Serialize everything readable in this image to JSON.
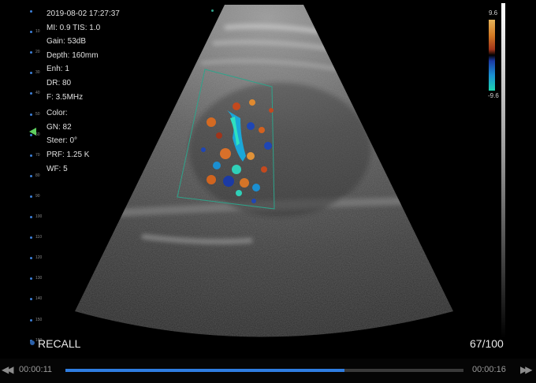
{
  "info": {
    "timestamp": "2019-08-02 17:27:37",
    "mi_tis": "MI: 0.9  TIS: 1.0",
    "gain": "Gain: 53dB",
    "depth": "Depth: 160mm",
    "enh": "Enh: 1",
    "dr": "DR: 80",
    "freq": "F: 3.5MHz",
    "color": "Color:",
    "gn": "GN: 82",
    "steer": "Steer: 0°",
    "prf": "PRF: 1.25 K",
    "wf": "WF: 5"
  },
  "depth_scale": [
    "10",
    "20",
    "30",
    "40",
    "50",
    "60",
    "70",
    "80",
    "90",
    "100",
    "110",
    "120",
    "130",
    "140",
    "150",
    "160"
  ],
  "colorbar": {
    "top": "9.6",
    "bottom": "-9.6"
  },
  "recall_label": "RECALL",
  "frame_counter": "67/100",
  "playback": {
    "current": "00:00:11",
    "total": "00:00:16",
    "progress": 0.7
  },
  "colors": {
    "accent": "#2f7de1",
    "roi_box": "#2ea38a",
    "focus": "#5fcf5f"
  },
  "icons": {
    "rewind": "rewind-icon",
    "fast_forward": "fast-forward-icon"
  }
}
